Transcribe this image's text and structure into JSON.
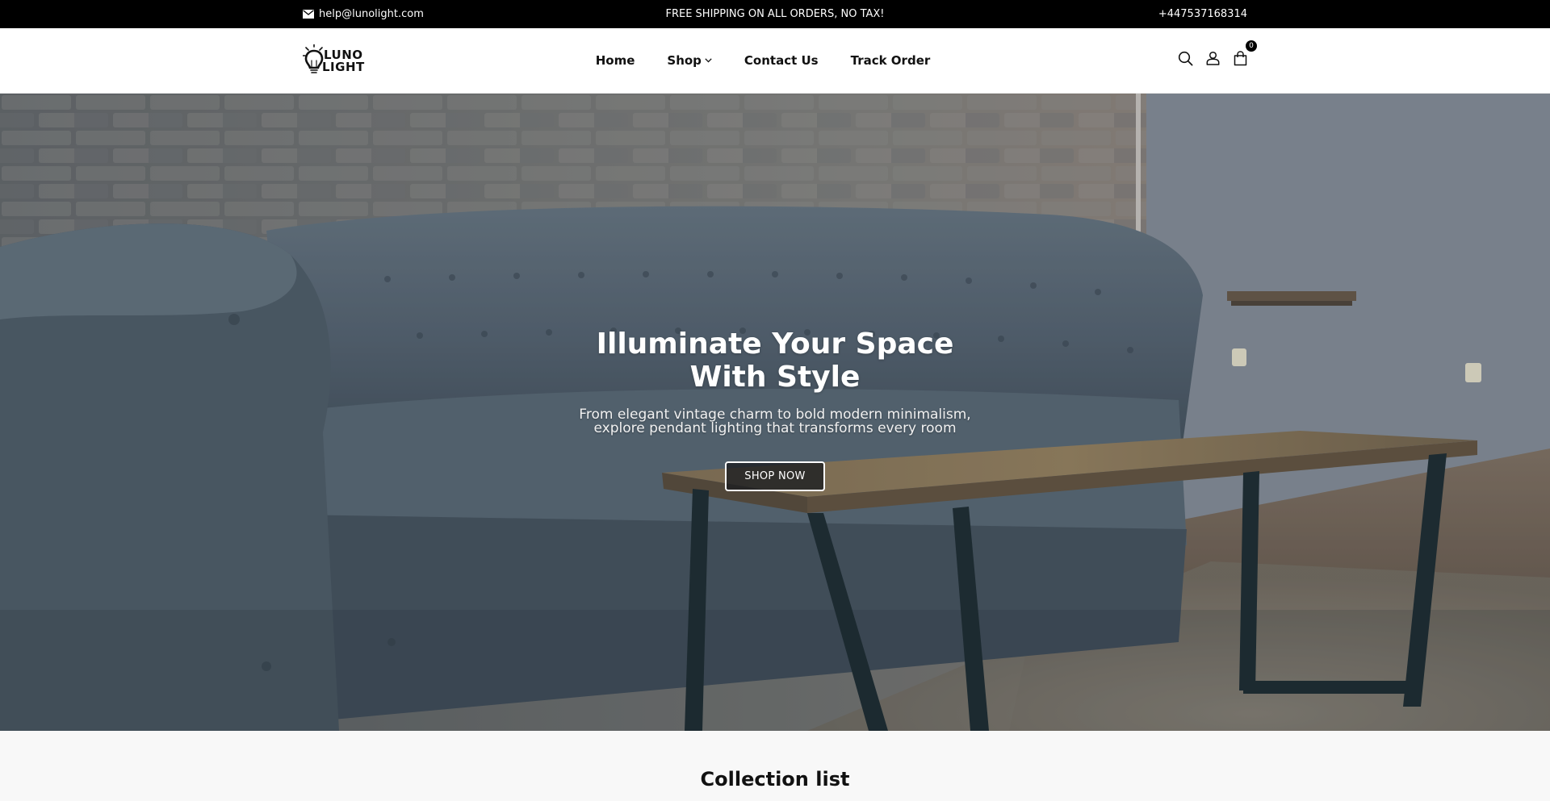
{
  "announcement": {
    "email": "help@lunolight.com",
    "promo": "FREE SHIPPING ON ALL ORDERS, NO TAX!",
    "phone": "+447537168314"
  },
  "header": {
    "logo_line1": "LUNO",
    "logo_line2": "LIGHT",
    "nav": [
      {
        "label": "Home"
      },
      {
        "label": "Shop",
        "has_dropdown": true
      },
      {
        "label": "Contact Us"
      },
      {
        "label": "Track Order"
      }
    ],
    "icons": [
      "search-icon",
      "user-icon",
      "cart-icon"
    ],
    "cart_count": "0"
  },
  "hero": {
    "title": "Illuminate Your Space With Style",
    "subtitle": "From elegant vintage charm to bold modern minimalism, explore pendant lighting that transforms every room",
    "button_label": "SHOP NOW"
  },
  "collection": {
    "title": "Collection list"
  },
  "colors": {
    "topbar_bg": "#000000",
    "header_bg": "#ffffff",
    "text_dark": "#111111",
    "sofa": "#5b6a78",
    "table_top": "#8a7556"
  }
}
